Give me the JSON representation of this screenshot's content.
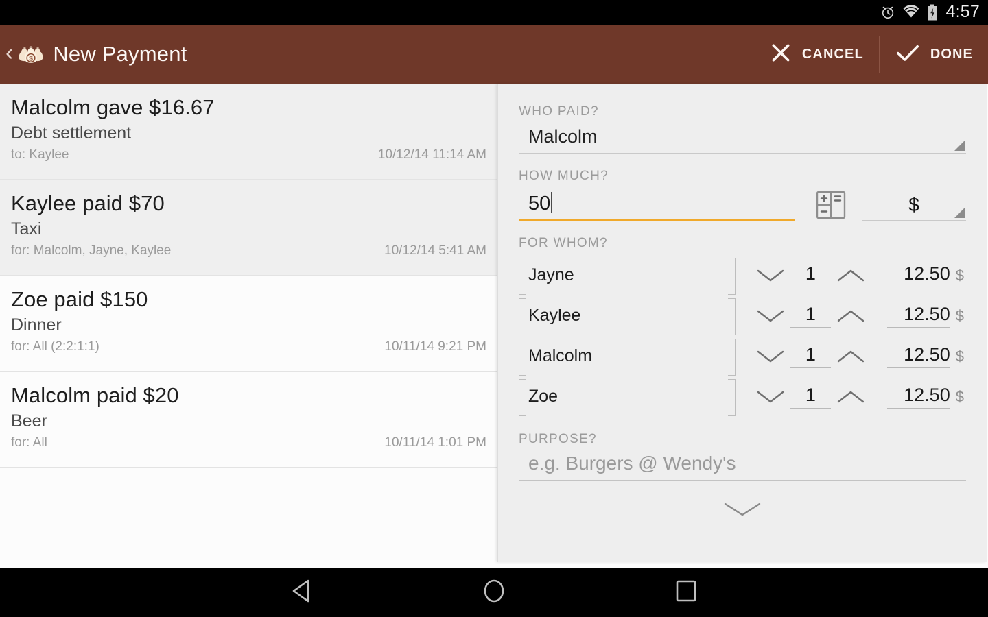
{
  "statusbar": {
    "time": "4:57",
    "icons": [
      "alarm-clock-icon",
      "wifi-icon",
      "battery-charging-icon"
    ]
  },
  "actionbar": {
    "back_glyph": "‹",
    "app_icon": "money-bags-icon",
    "title": "New Payment",
    "cancel_label": "CANCEL",
    "done_label": "DONE",
    "background_color": "#6f3829",
    "text_color": "#fdf8f5"
  },
  "transactions": [
    {
      "title": "Malcolm gave $16.67",
      "subtitle": "Debt settlement",
      "participants": "to: Kaylee",
      "date": "10/12/14 11:14 AM"
    },
    {
      "title": "Kaylee paid $70",
      "subtitle": "Taxi",
      "participants": "for: Malcolm, Jayne, Kaylee",
      "date": "10/12/14 5:41 AM"
    },
    {
      "title": "Zoe paid $150",
      "subtitle": "Dinner",
      "participants": "for: All (2:2:1:1)",
      "date": "10/11/14 9:21 PM"
    },
    {
      "title": "Malcolm paid $20",
      "subtitle": "Beer",
      "participants": "for: All",
      "date": "10/11/14 1:01 PM"
    }
  ],
  "form": {
    "who_paid": {
      "label": "WHO PAID?",
      "value": "Malcolm"
    },
    "how_much": {
      "label": "HOW MUCH?",
      "value": "50",
      "calculator_icon": "calculator-icon",
      "currency": "$",
      "focus_color": "#f0a92b"
    },
    "for_whom": {
      "label": "FOR WHOM?",
      "rows": [
        {
          "name": "Jayne",
          "quantity": "1",
          "share": "12.50",
          "currency": "$"
        },
        {
          "name": "Kaylee",
          "quantity": "1",
          "share": "12.50",
          "currency": "$"
        },
        {
          "name": "Malcolm",
          "quantity": "1",
          "share": "12.50",
          "currency": "$"
        },
        {
          "name": "Zoe",
          "quantity": "1",
          "share": "12.50",
          "currency": "$"
        }
      ]
    },
    "purpose": {
      "label": "PURPOSE?",
      "placeholder": "e.g. Burgers @ Wendy's",
      "value": ""
    },
    "expand_icon": "chevron-down-icon"
  },
  "navbar": {
    "back": "back-triangle-icon",
    "home": "home-circle-icon",
    "recents": "recents-square-icon"
  }
}
